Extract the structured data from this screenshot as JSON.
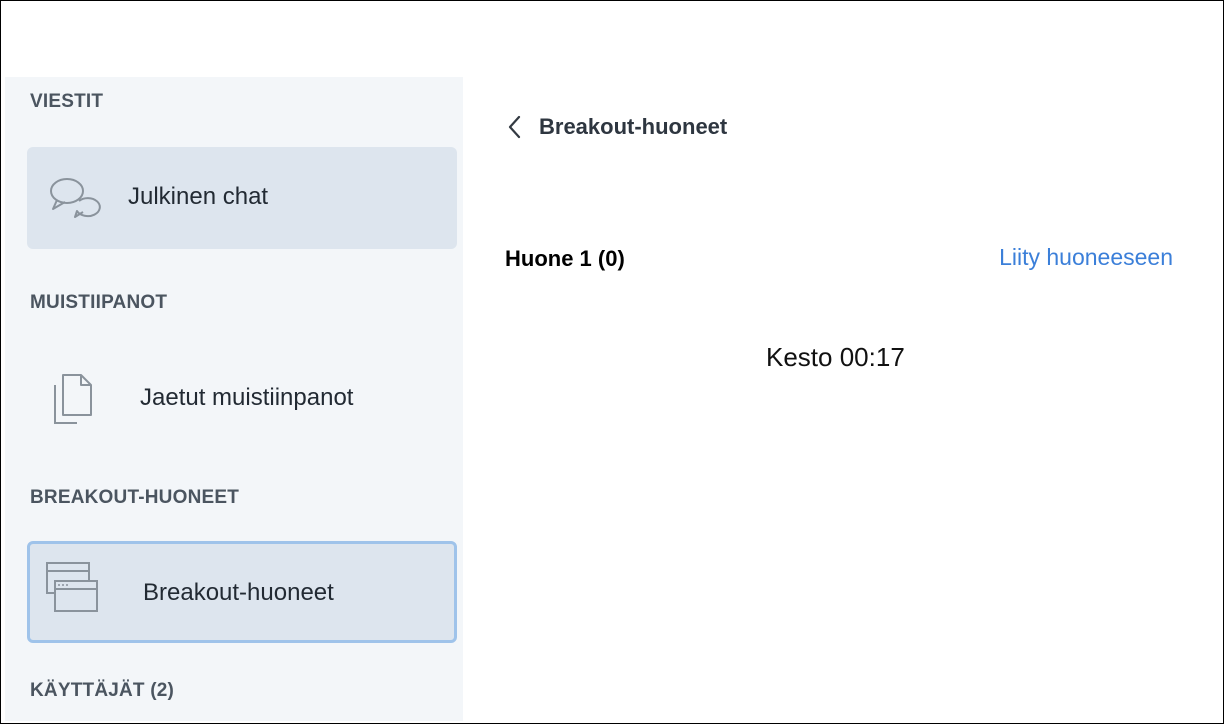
{
  "sidebar": {
    "sections": {
      "messages": "VIESTIT",
      "notes": "MUISTIIPANOT",
      "breakouts": "BREAKOUT-HUONEET",
      "users": "KÄYTTÄJÄT (2)"
    },
    "items": {
      "public_chat": {
        "label": "Julkinen chat",
        "icon": "chat-bubbles-icon"
      },
      "shared_notes": {
        "label": "Jaetut muistiinpanot",
        "icon": "document-icon"
      },
      "breakout_rooms": {
        "label": "Breakout-huoneet",
        "icon": "windows-icon"
      }
    }
  },
  "panel": {
    "back_icon": "chevron-left-icon",
    "title": "Breakout-huoneet",
    "room": {
      "name": "Huone 1 (0)",
      "join_label": "Liity huoneeseen",
      "duration": "Kesto 00:17"
    }
  },
  "colors": {
    "sidebar_bg": "#f3f6f9",
    "selected_bg": "#dde5ee",
    "active_border": "#9fc3ea",
    "link": "#3b7fd9",
    "heading": "#4b5560"
  }
}
